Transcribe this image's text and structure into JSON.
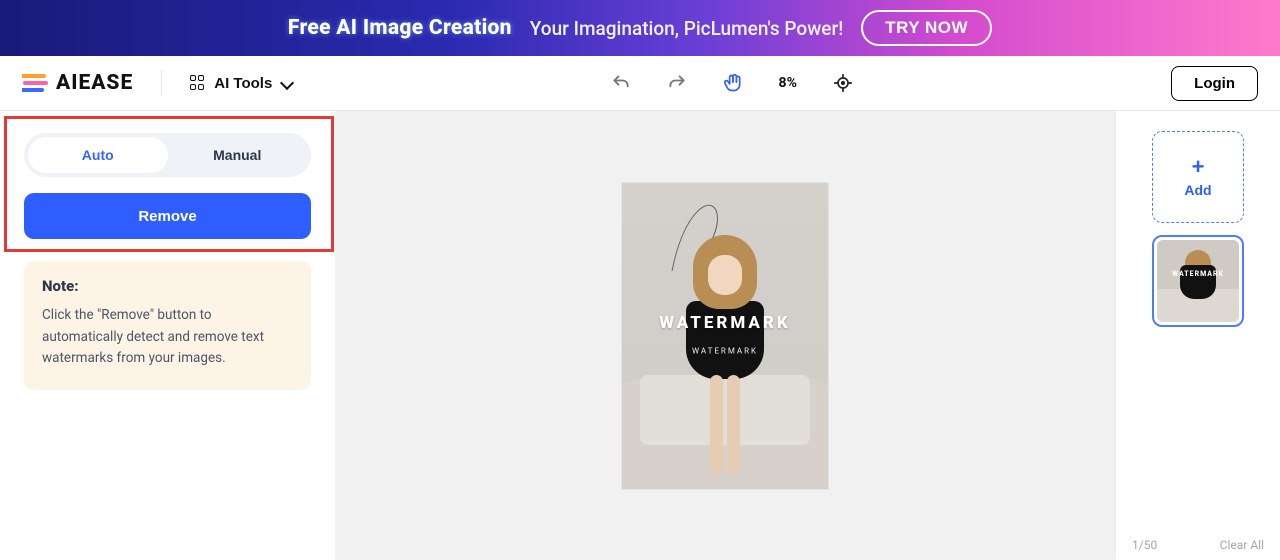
{
  "promo": {
    "title": "Free AI Image Creation",
    "subtitle": "Your Imagination, PicLumen's Power!",
    "cta": "TRY NOW"
  },
  "brand": {
    "name": "AIEASE"
  },
  "toolbar": {
    "ai_tools_label": "AI Tools",
    "zoom_label": "8%",
    "login_label": "Login"
  },
  "sidebar": {
    "tabs": {
      "auto": "Auto",
      "manual": "Manual",
      "active": "auto"
    },
    "remove_label": "Remove",
    "note": {
      "title": "Note:",
      "body": "Click the \"Remove\" button to automatically detect and remove text watermarks from your images."
    }
  },
  "canvas": {
    "watermark_main": "WATERMARK",
    "watermark_sub": "WATERMARK"
  },
  "rightbar": {
    "add_label": "Add",
    "counter": "1/50",
    "clear_all_label": "Clear All",
    "thumb_watermark": "WATERMARK"
  }
}
